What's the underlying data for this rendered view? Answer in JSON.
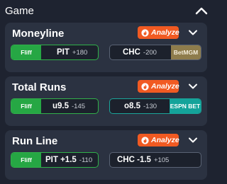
{
  "header": {
    "title": "Game"
  },
  "colors": {
    "background": "#1e2330",
    "card": "#2b3241",
    "analyze": "#f15a22",
    "fliff": "#26a744",
    "betmgm": "#8e7c4c",
    "espn_bet": "#14a39a"
  },
  "icons": {
    "header_chevron": "chevron-up-icon",
    "card_chevron": "chevron-down-icon",
    "analyze": "flame-icon"
  },
  "cards": [
    {
      "title": "Moneyline",
      "analyze_label": "Analyze",
      "left": {
        "book": "Fliff",
        "label": "PIT",
        "odds": "+180"
      },
      "right": {
        "book": "BetMGM",
        "label": "CHC",
        "odds": "-200"
      }
    },
    {
      "title": "Total Runs",
      "analyze_label": "Analyze",
      "left": {
        "book": "Fliff",
        "label": "u9.5",
        "odds": "-145"
      },
      "right": {
        "book": "ESPN BET",
        "label": "o8.5",
        "odds": "-130"
      }
    },
    {
      "title": "Run Line",
      "analyze_label": "Analyze",
      "left": {
        "book": "Fliff",
        "label": "PIT +1.5",
        "odds": "-110"
      },
      "right": {
        "book": "",
        "label": "CHC -1.5",
        "odds": "+105"
      }
    }
  ]
}
